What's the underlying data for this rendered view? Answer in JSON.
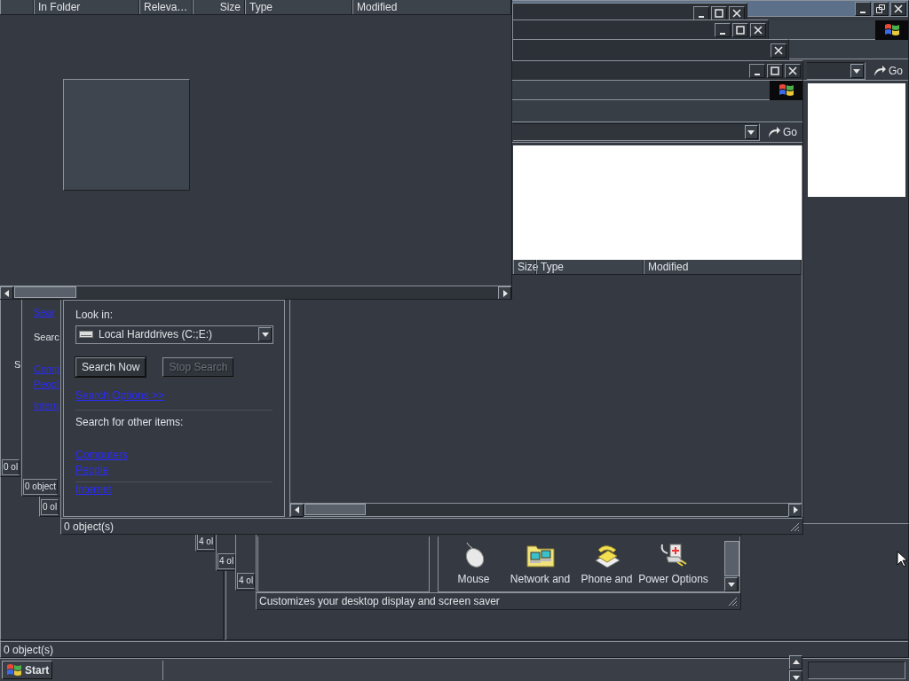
{
  "desktop_window": {
    "go_label": "Go",
    "status": "0 object(s)"
  },
  "results_window": {
    "columns": [
      "In Folder",
      "Releva…",
      "Size",
      "Type",
      "Modified"
    ]
  },
  "search_window": {
    "go_label": "Go",
    "columns": [
      "Size",
      "Type",
      "Modified"
    ],
    "status": "0 object(s)",
    "search_pane": {
      "look_in_label": "Look in:",
      "look_in_value": "Local Harddrives (C:;E:)",
      "buttons": [
        {
          "label": "Search Now",
          "disabled": false
        },
        {
          "label": "Stop Search",
          "disabled": true
        }
      ],
      "options_link": "Search Options >>",
      "other_items_label": "Search for other items:",
      "links": [
        "Computers",
        "People"
      ],
      "internet_link": "Internet"
    }
  },
  "background_windows": [
    {
      "status": "0 ol",
      "fragments": [
        {
          "text": "S",
          "kind": "text"
        }
      ]
    },
    {
      "status": "0 object",
      "fragments": [
        {
          "text": "Sear",
          "kind": "link"
        },
        {
          "text": "Searc",
          "kind": "text"
        },
        {
          "text": "Comp",
          "kind": "link"
        },
        {
          "text": "Peopl",
          "kind": "link"
        },
        {
          "text": "Intern",
          "kind": "link"
        }
      ]
    },
    {
      "status": "0 ol"
    },
    {
      "status": "4 ol"
    },
    {
      "status": "4 ol"
    },
    {
      "status": "4 ol"
    }
  ],
  "control_panel": {
    "items": [
      {
        "label": "Mouse",
        "kind": "mouse"
      },
      {
        "label": "Network and",
        "kind": "network"
      },
      {
        "label": "Phone and",
        "kind": "phone"
      },
      {
        "label": "Power Options",
        "kind": "power"
      }
    ],
    "status": "Customizes your desktop display and screen saver"
  },
  "taskbar": {
    "start_label": "Start"
  }
}
